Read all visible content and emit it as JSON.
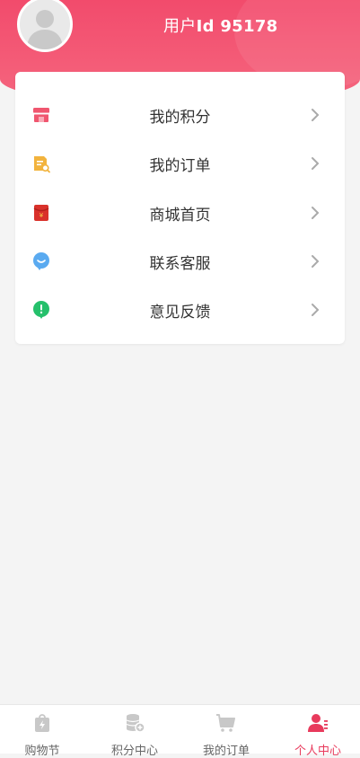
{
  "header": {
    "user_prefix": "用户",
    "user_id_label": "Id 95178",
    "gradient_top": "#f24b6c",
    "gradient_bottom": "#f5677f"
  },
  "menu": [
    {
      "label": "我的积分",
      "icon": "shop-icon",
      "color": "#f0566f"
    },
    {
      "label": "我的订单",
      "icon": "order-doc-icon",
      "color": "#f2b33d"
    },
    {
      "label": "商城首页",
      "icon": "red-envelope-icon",
      "color": "#d9312b"
    },
    {
      "label": "联系客服",
      "icon": "chat-bubble-icon",
      "color": "#5aaaf0"
    },
    {
      "label": "意见反馈",
      "icon": "exclamation-icon",
      "color": "#25c06b"
    }
  ],
  "tabs": [
    {
      "label": "购物节",
      "icon": "shopping-bag-icon",
      "active": false
    },
    {
      "label": "积分中心",
      "icon": "coins-icon",
      "active": false
    },
    {
      "label": "我的订单",
      "icon": "cart-icon",
      "active": false
    },
    {
      "label": "个人中心",
      "icon": "person-icon",
      "active": true
    }
  ],
  "colors": {
    "accent": "#e83a5c",
    "tab_inactive": "#c8c8c8",
    "background": "#f4f4f4"
  }
}
